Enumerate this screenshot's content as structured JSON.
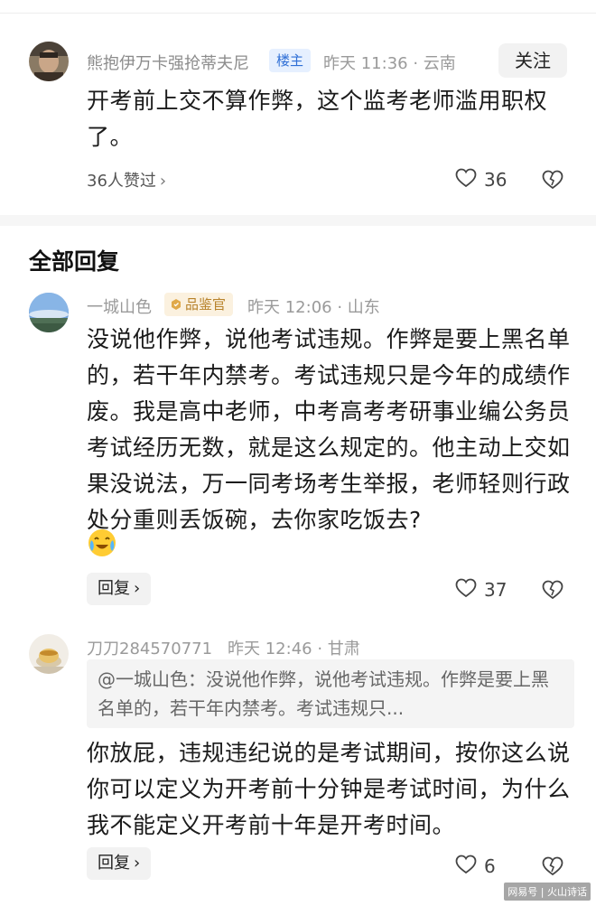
{
  "main_comment": {
    "author": "熊抱伊万卡强抢蒂夫尼",
    "badge": "楼主",
    "time_location": "昨天 11:36 · 云南",
    "follow_label": "关注",
    "text": "开考前上交不算作弊，这个监考老师滥用职权了。",
    "likers_label": "36人赞过",
    "like_count": "36"
  },
  "section_title": "全部回复",
  "replies": [
    {
      "author": "一城山色",
      "badge": "品鉴官",
      "time_location": "昨天 12:06 · 山东",
      "text": "没说他作弊，说他考试违规。作弊是要上黑名单的，若干年内禁考。考试违规只是今年的成绩作废。我是高中老师，中考高考考研事业编公务员考试经历无数，就是这么规定的。他主动上交如果没说法，万一同考场考生举报，老师轻则行政处分重则丢饭碗，去你家吃饭去?",
      "reply_label": "回复",
      "like_count": "37"
    },
    {
      "author": "刀刀284570771",
      "time_location": "昨天 12:46 · 甘肃",
      "quote": "@一城山色：没说他作弊，说他考试违规。作弊是要上黑名单的，若干年内禁考。考试违规只...",
      "text": "你放屁，违规违纪说的是考试期间，按你这么说你可以定义为开考前十分钟是考试时间，为什么我不能定义开考前十年是开考时间。",
      "reply_label": "回复",
      "like_count": "6"
    }
  ],
  "watermark": "网易号 | 火山诗话",
  "colors": {
    "owner_badge_bg": "#e6f0ff",
    "owner_badge_text": "#2f6fd6",
    "expert_badge_bg": "#fbf1df",
    "expert_badge_text": "#b7822a"
  },
  "icons": [
    "heart-icon",
    "heart-break-icon",
    "chevron-right-icon",
    "medal-icon",
    "crying-laughing-emoji"
  ]
}
